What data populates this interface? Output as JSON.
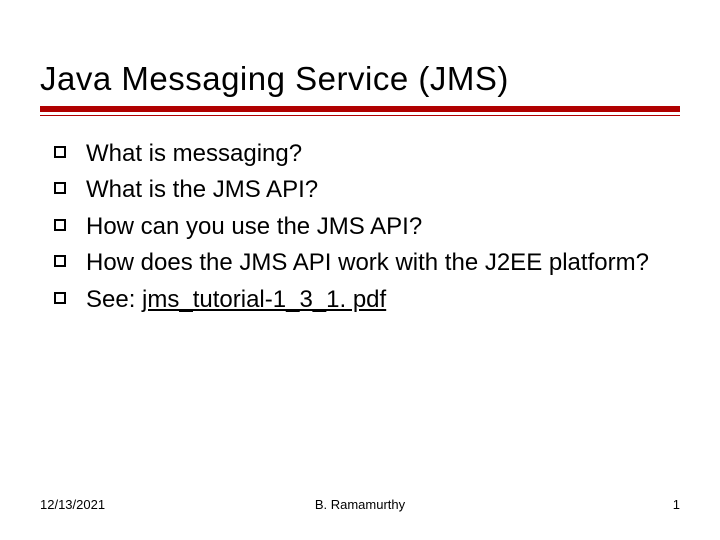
{
  "title": "Java Messaging Service (JMS)",
  "bullets": [
    {
      "text": "What is messaging?"
    },
    {
      "text": "What is the JMS API?"
    },
    {
      "text": "How can you use the JMS API?"
    },
    {
      "text": "How does the JMS API work with the J2EE platform?"
    },
    {
      "prefix": "See: ",
      "link": "jms_tutorial-1_3_1. pdf"
    }
  ],
  "footer": {
    "date": "12/13/2021",
    "author": "B. Ramamurthy",
    "page": "1"
  }
}
